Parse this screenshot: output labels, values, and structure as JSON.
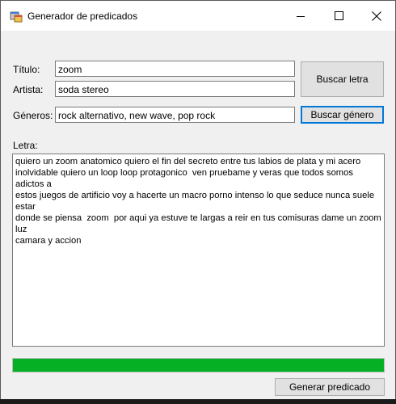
{
  "window": {
    "title": "Generador de predicados"
  },
  "form": {
    "titulo_label": "Título:",
    "titulo_value": "zoom",
    "artista_label": "Artista:",
    "artista_value": "soda stereo",
    "generos_label": "Géneros:",
    "generos_value": "rock alternativo, new wave, pop rock",
    "letra_label": "Letra:",
    "letra_value": "quiero un zoom anatomico quiero el fin del secreto entre tus labios de plata y mi acero\ninolvidable quiero un loop loop protagonico  ven pruebame y veras que todos somos adictos a\nestos juegos de artificio voy a hacerte un macro porno intenso lo que seduce nunca suele estar\ndonde se piensa  zoom  por aqui ya estuve te largas a reir en tus comisuras dame un zoom luz\ncamara y accion"
  },
  "buttons": {
    "buscar_letra": "Buscar letra",
    "buscar_genero": "Buscar género",
    "generar_predicado": "Generar predicado"
  },
  "progress": {
    "value_percent": 100,
    "color": "#06b025"
  },
  "icons": {
    "app": "app-window-icon",
    "minimize": "minimize-icon",
    "maximize": "maximize-icon",
    "close": "close-icon"
  }
}
